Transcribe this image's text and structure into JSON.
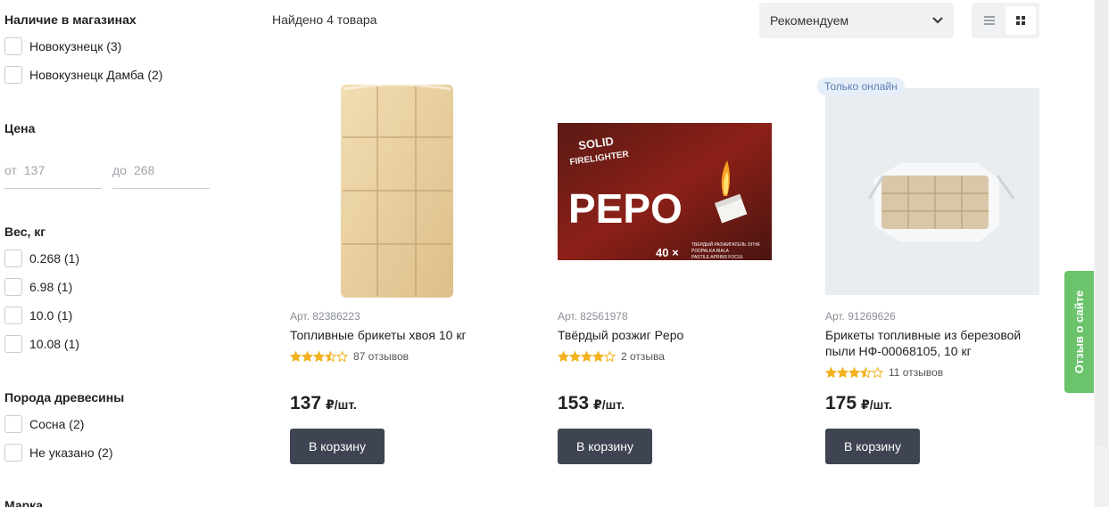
{
  "filters": {
    "availability": {
      "title": "Наличие в магазинах",
      "options": [
        "Новокузнецк (3)",
        "Новокузнецк Дамба (2)"
      ]
    },
    "price": {
      "title": "Цена",
      "from_prefix": "от",
      "from_placeholder": "137",
      "to_prefix": "до",
      "to_placeholder": "268"
    },
    "weight": {
      "title": "Вес, кг",
      "options": [
        "0.268 (1)",
        "6.98 (1)",
        "10.0 (1)",
        "10.08 (1)"
      ]
    },
    "wood": {
      "title": "Порода древесины",
      "options": [
        "Сосна (2)",
        "Не указано (2)"
      ]
    },
    "brand": {
      "title": "Марка"
    }
  },
  "toolbar": {
    "found": "Найдено 4 товара",
    "sort_selected": "Рекомендуем"
  },
  "products": [
    {
      "art": "Арт. 82386223",
      "name": "Топливные брикеты хвоя 10 кг",
      "rating": 3.5,
      "reviews": "87 отзывов",
      "price": "137",
      "unit": "₽/шт.",
      "button": "В корзину"
    },
    {
      "art": "Арт. 82561978",
      "name": "Твёрдый розжиг Pepo",
      "rating": 4,
      "reviews": "2 отзыва",
      "price": "153",
      "unit": "₽/шт.",
      "button": "В корзину",
      "image_text": {
        "line1": "SOLID",
        "line2": "FIRELIGHTER",
        "brand": "PEPO",
        "count": "40 ×",
        "small1": "ТВЕРДЫЙ РАЗЖИГАТЕЛЬ ОГНЯ",
        "small2": "PODPALKA BIALA",
        "small3": "PASTILE APRINS FOCUL"
      }
    },
    {
      "badge": "Только онлайн",
      "art": "Арт. 91269626",
      "name": "Брикеты топливные из березовой пыли НФ-00068105, 10 кг",
      "rating": 3.5,
      "reviews": "11 отзывов",
      "price": "175",
      "unit": "₽/шт.",
      "button": "В корзину"
    }
  ],
  "feedback_tab": "Отзыв о сайте",
  "colors": {
    "star": "#f2b21e",
    "button": "#3e4452",
    "feedback": "#6bc36b",
    "badge_bg": "#e5eef9"
  }
}
